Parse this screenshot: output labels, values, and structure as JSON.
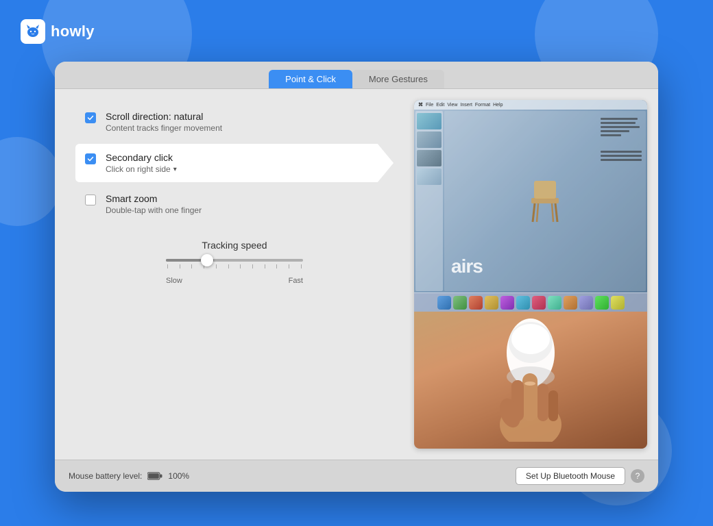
{
  "app": {
    "name": "howly",
    "logo_alt": "Howly logo"
  },
  "tabs": [
    {
      "id": "point-click",
      "label": "Point & Click",
      "active": true
    },
    {
      "id": "more-gestures",
      "label": "More Gestures",
      "active": false
    }
  ],
  "settings": [
    {
      "id": "scroll-direction",
      "checked": true,
      "title": "Scroll direction: natural",
      "subtitle": "Content tracks finger movement",
      "has_dropdown": false,
      "highlighted": false
    },
    {
      "id": "secondary-click",
      "checked": true,
      "title": "Secondary click",
      "subtitle": "Click on right side",
      "has_dropdown": true,
      "highlighted": true
    },
    {
      "id": "smart-zoom",
      "checked": false,
      "title": "Smart zoom",
      "subtitle": "Double-tap with one finger",
      "has_dropdown": false,
      "highlighted": false
    }
  ],
  "tracking_speed": {
    "label": "Tracking speed",
    "slow_label": "Slow",
    "fast_label": "Fast",
    "value": 30
  },
  "bottom_bar": {
    "battery_label": "Mouse battery level:",
    "battery_percent": "100%",
    "setup_button_label": "Set Up Bluetooth Mouse",
    "help_button_label": "?"
  }
}
